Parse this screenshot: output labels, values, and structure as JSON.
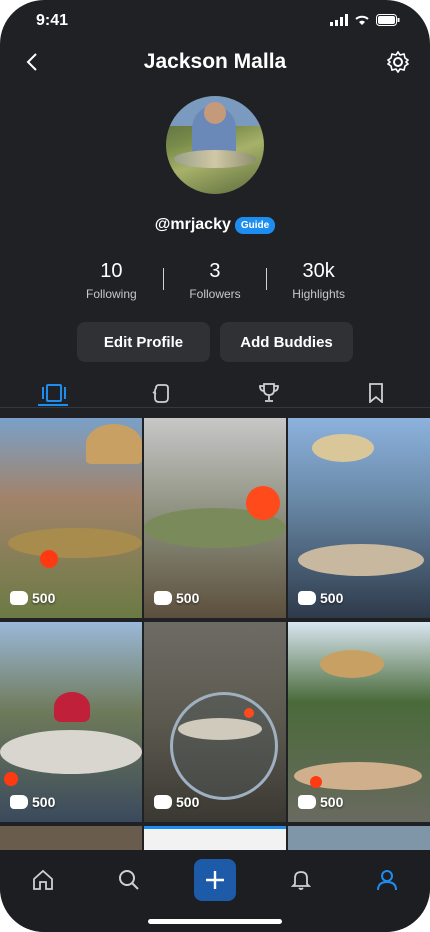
{
  "status": {
    "time": "9:41"
  },
  "header": {
    "title": "Jackson Malla"
  },
  "profile": {
    "handle": "@mrjacky",
    "badge": "Guide"
  },
  "stats": [
    {
      "value": "10",
      "label": "Following"
    },
    {
      "value": "3",
      "label": "Followers"
    },
    {
      "value": "30k",
      "label": "Highlights"
    }
  ],
  "actions": {
    "edit": "Edit Profile",
    "buddies": "Add Buddies"
  },
  "tabs": [
    {
      "icon": "posts-icon",
      "active": true
    },
    {
      "icon": "glove-icon",
      "active": false
    },
    {
      "icon": "trophy-icon",
      "active": false
    },
    {
      "icon": "bookmark-icon",
      "active": false
    }
  ],
  "posts": [
    {
      "likes": "500"
    },
    {
      "likes": "500"
    },
    {
      "likes": "500"
    },
    {
      "likes": "500"
    },
    {
      "likes": "500"
    },
    {
      "likes": "500"
    }
  ],
  "colors": {
    "accent": "#1d8ef0",
    "background": "#1f2125",
    "nav_active": "#1d8ef0"
  }
}
